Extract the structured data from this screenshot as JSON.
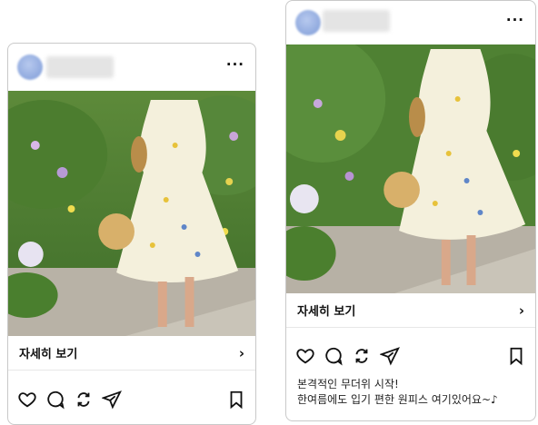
{
  "posts": [
    {
      "id_label": "left-post",
      "more_menu": "···",
      "detail_label": "자세히 보기",
      "detail_chevron": "›",
      "caption_lines": []
    },
    {
      "id_label": "right-post",
      "more_menu": "···",
      "detail_label": "자세히 보기",
      "detail_chevron": "›",
      "caption_lines": [
        "본격적인 무더위 시작!",
        "한여름에도 입기 편한 원피스 여기있어요~♪"
      ]
    }
  ],
  "icons": [
    "heart-icon",
    "comment-icon",
    "repost-icon",
    "share-icon",
    "bookmark-icon"
  ],
  "colors": {
    "card_border": "#c9c9c9",
    "divider": "#e7e7e7",
    "text": "#111111"
  }
}
